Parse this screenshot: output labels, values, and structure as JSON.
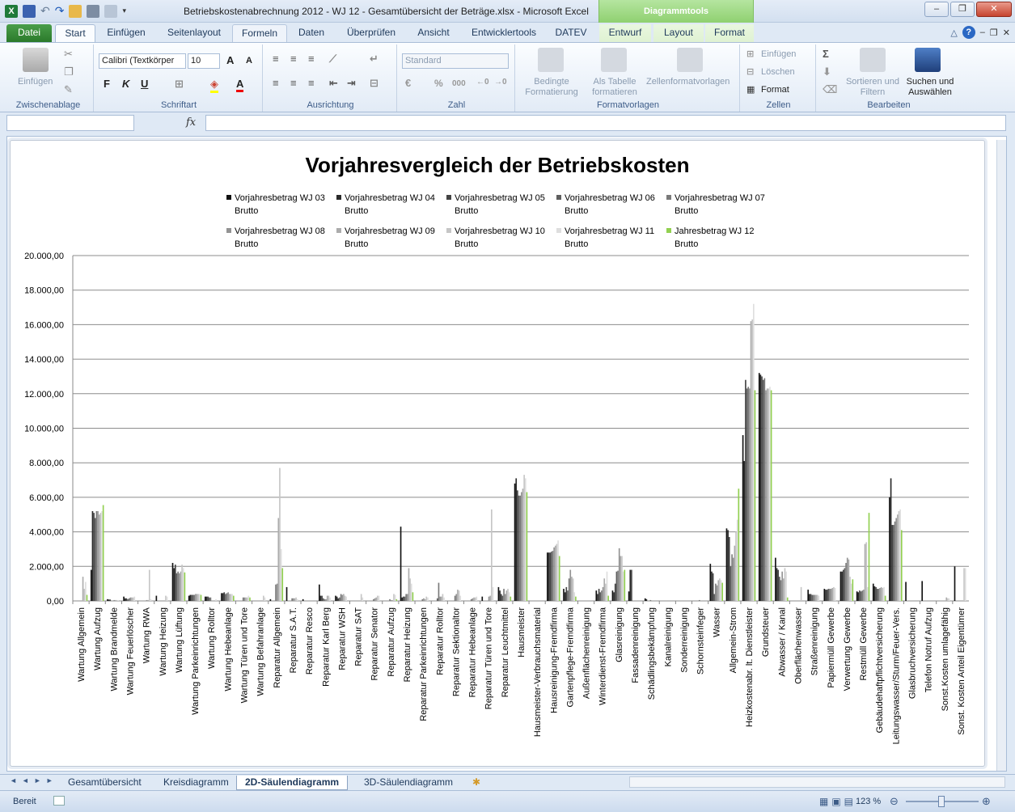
{
  "window": {
    "title": "Betriebskostenabrechnung 2012 - WJ 12 - Gesamtübersicht der Beträge.xlsx - Microsoft Excel",
    "context_group": "Diagrammtools"
  },
  "tabs": [
    "Datei",
    "Start",
    "Einfügen",
    "Seitenlayout",
    "Formeln",
    "Daten",
    "Überprüfen",
    "Ansicht",
    "Entwicklertools",
    "DATEV",
    "Entwurf",
    "Layout",
    "Format"
  ],
  "active_tab": "Start",
  "ribbon": {
    "clipboard": {
      "label": "Zwischenablage",
      "paste": "Einfügen"
    },
    "font": {
      "label": "Schriftart",
      "name": "Calibri (Textkörper",
      "size": "10",
      "bold": "F",
      "italic": "K",
      "underline": "U",
      "grow": "A",
      "shrink": "A",
      "color_glyph": "A"
    },
    "alignment": {
      "label": "Ausrichtung"
    },
    "number": {
      "label": "Zahl",
      "format": "Standard",
      "percent": "%",
      "thousands": "000"
    },
    "styles": {
      "label": "Formatvorlagen",
      "conditional": "Bedingte Formatierung",
      "as_table": "Als Tabelle formatieren",
      "cell_styles": "Zellenformatvorlagen"
    },
    "cells": {
      "label": "Zellen",
      "insert": "Einfügen",
      "delete": "Löschen",
      "format": "Format"
    },
    "editing": {
      "label": "Bearbeiten",
      "sum": "Σ",
      "sort": "Sortieren und Filtern",
      "find": "Suchen und Auswählen"
    }
  },
  "formula_bar": {
    "name_box": "",
    "fx": "fx",
    "content": ""
  },
  "sheet_tabs": [
    "Gesamtübersicht",
    "Kreisdiagramm",
    "2D-Säulendiagramm",
    "3D-Säulendiagramm"
  ],
  "active_sheet": "2D-Säulendiagramm",
  "status": {
    "ready": "Bereit",
    "zoom": "123 %"
  },
  "chart_data": {
    "type": "bar",
    "title": "Vorjahresvergleich der Betriebskosten",
    "legend_position": "top",
    "grid": true,
    "ylim": [
      0,
      20000
    ],
    "yticks": [
      "0,00",
      "2.000,00",
      "4.000,00",
      "6.000,00",
      "8.000,00",
      "10.000,00",
      "12.000,00",
      "14.000,00",
      "16.000,00",
      "18.000,00",
      "20.000,00"
    ],
    "categories": [
      "Wartung Allgemein",
      "Wartung Aufzug",
      "Wartung Brandmelde",
      "Wartung Feuerlöscher",
      "Wartung RWA",
      "Wartung Heizung",
      "Wartung Lüftung",
      "Wartung Parkeinrichtungen",
      "Wartung Rolltor",
      "Wartung Hebeanlage",
      "Wartung Türen und Tore",
      "Wartung Befahranlage",
      "Reparatur Allgemein",
      "Reparatur S.A.T.",
      "Reparatur Resco",
      "Reparatur Karl Berg",
      "Reparatur WSH",
      "Reparatur SAT",
      "Reparatur Senator",
      "Reparatur Aufzug",
      "Reparatur Heizung",
      "Reparatur Parkeinrichtungen",
      "Reparatur Rolltor",
      "Reparatur Sektionaltor",
      "Reparatur Hebeanlage",
      "Reparatur Türen und Tore",
      "Reparatur Leuchtmittel",
      "Hausmeister",
      "Hausmeister-Verbrauchsmaterial",
      "Hausreinigung-Fremdfirma",
      "Gartenpflege-Fremdfirma",
      "Außenflächenreinigung",
      "Winterdienst-Fremdfirma",
      "Glasreinigung",
      "Fassadenreinigung",
      "Schädlingsbekämpfung",
      "Kanalreinigung",
      "Sonderreinigung",
      "Schornsteinfeger",
      "Wasser",
      "Allgemein-Strom",
      "Heizkostenabr. lt. Dienstleister",
      "Grundsteuer",
      "Abwasser / Kanal",
      "Oberflächenwasser",
      "Straßenreinigung",
      "Papiermüll Gewerbe",
      "Verwertung Gewerbe",
      "Restmüll Gewerbe",
      "Gebäudehaftpflichtversicherung",
      "Leitungswasser/Sturm/Feuer-Vers.",
      "Glasbruchversicherung",
      "Telefon Notruf Aufzug",
      "Sonst.Kosten umlagefähig",
      "Sonst. Kosten Anteil Eigentümer"
    ],
    "series": [
      {
        "name": "Vorjahresbetrag WJ 03 Brutto",
        "color": "#111111",
        "values": [
          0,
          1800,
          100,
          250,
          0,
          300,
          2200,
          300,
          250,
          450,
          0,
          0,
          100,
          800,
          100,
          950,
          300,
          0,
          0,
          0,
          4300,
          0,
          0,
          0,
          0,
          250,
          800,
          6800,
          0,
          2800,
          700,
          0,
          600,
          600,
          550,
          150,
          0,
          0,
          0,
          2150,
          4200,
          9600,
          13200,
          2500,
          0,
          650,
          700,
          1700,
          550,
          1000,
          6000,
          1100,
          1150,
          0,
          2000
        ]
      },
      {
        "name": "Vorjahresbetrag WJ 04 Brutto",
        "color": "#2a2a2a",
        "values": [
          0,
          5200,
          80,
          150,
          0,
          0,
          1900,
          350,
          250,
          450,
          0,
          0,
          0,
          0,
          0,
          300,
          250,
          0,
          0,
          0,
          200,
          0,
          0,
          0,
          0,
          0,
          600,
          7100,
          0,
          2800,
          500,
          0,
          400,
          500,
          1800,
          100,
          0,
          0,
          0,
          1700,
          4100,
          8100,
          13100,
          1900,
          0,
          400,
          650,
          1700,
          500,
          850,
          7100,
          0,
          0,
          0,
          0
        ]
      },
      {
        "name": "Vorjahresbetrag WJ 05 Brutto",
        "color": "#444444",
        "values": [
          0,
          5100,
          80,
          150,
          0,
          0,
          2100,
          350,
          250,
          500,
          0,
          0,
          0,
          0,
          0,
          300,
          150,
          0,
          0,
          0,
          250,
          0,
          0,
          0,
          0,
          0,
          400,
          6400,
          0,
          2800,
          800,
          0,
          700,
          1000,
          1800,
          0,
          0,
          0,
          0,
          1600,
          3700,
          12800,
          13000,
          1800,
          0,
          400,
          650,
          1800,
          600,
          800,
          4400,
          0,
          0,
          0,
          0
        ]
      },
      {
        "name": "Vorjahresbetrag WJ 06 Brutto",
        "color": "#5f5f5f",
        "values": [
          0,
          4800,
          0,
          100,
          0,
          0,
          1600,
          350,
          200,
          400,
          0,
          0,
          0,
          0,
          0,
          150,
          200,
          0,
          0,
          0,
          250,
          0,
          150,
          0,
          0,
          0,
          300,
          6100,
          0,
          2850,
          600,
          0,
          500,
          1700,
          0,
          0,
          0,
          0,
          0,
          400,
          2000,
          12300,
          12800,
          1400,
          0,
          350,
          700,
          1900,
          550,
          700,
          4400,
          0,
          0,
          0,
          0
        ]
      },
      {
        "name": "Vorjahresbetrag WJ 07 Brutto",
        "color": "#7a7a7a",
        "values": [
          0,
          5200,
          0,
          150,
          0,
          0,
          1700,
          350,
          200,
          450,
          200,
          0,
          950,
          150,
          0,
          100,
          400,
          0,
          100,
          100,
          400,
          100,
          1050,
          300,
          100,
          0,
          700,
          6100,
          0,
          2900,
          1300,
          0,
          600,
          1750,
          0,
          50,
          0,
          0,
          50,
          1000,
          2700,
          12400,
          12900,
          1200,
          0,
          350,
          700,
          2200,
          600,
          700,
          4600,
          0,
          0,
          0,
          0
        ]
      },
      {
        "name": "Vorjahresbetrag WJ 08 Brutto",
        "color": "#939393",
        "values": [
          0,
          5200,
          50,
          200,
          50,
          0,
          1600,
          400,
          0,
          500,
          200,
          0,
          1000,
          150,
          0,
          100,
          350,
          0,
          150,
          50,
          400,
          150,
          250,
          400,
          150,
          250,
          400,
          6300,
          0,
          3100,
          1800,
          0,
          800,
          3050,
          0,
          0,
          0,
          0,
          0,
          900,
          2500,
          12300,
          12200,
          1700,
          0,
          350,
          700,
          2500,
          650,
          750,
          4800,
          0,
          0,
          0,
          0
        ]
      },
      {
        "name": "Vorjahresbetrag WJ 09 Brutto",
        "color": "#acacac",
        "values": [
          1400,
          5000,
          50,
          200,
          50,
          0,
          1700,
          400,
          0,
          400,
          200,
          0,
          4800,
          150,
          0,
          300,
          400,
          0,
          200,
          50,
          1900,
          100,
          250,
          650,
          200,
          300,
          600,
          6500,
          0,
          3200,
          1400,
          0,
          1300,
          2600,
          0,
          0,
          0,
          0,
          0,
          1200,
          3200,
          16200,
          12300,
          1300,
          0,
          350,
          750,
          2400,
          3300,
          800,
          5000,
          0,
          0,
          200,
          0
        ]
      },
      {
        "name": "Vorjahresbetrag WJ 10 Brutto",
        "color": "#c6c6c6",
        "values": [
          700,
          5100,
          50,
          200,
          1800,
          300,
          2100,
          400,
          0,
          400,
          200,
          300,
          7700,
          200,
          0,
          300,
          300,
          400,
          300,
          400,
          1300,
          250,
          400,
          600,
          200,
          5300,
          700,
          7300,
          0,
          3300,
          1300,
          0,
          1000,
          2600,
          0,
          0,
          0,
          0,
          0,
          1300,
          4000,
          16300,
          12300,
          1900,
          800,
          350,
          800,
          1400,
          3400,
          750,
          5200,
          0,
          0,
          150,
          1900
        ]
      },
      {
        "name": "Vorjahresbetrag WJ 11 Brutto",
        "color": "#dedede",
        "values": [
          1100,
          5200,
          50,
          250,
          100,
          250,
          1900,
          400,
          100,
          400,
          300,
          200,
          3000,
          100,
          0,
          200,
          250,
          200,
          300,
          350,
          1000,
          200,
          200,
          300,
          250,
          800,
          500,
          7100,
          0,
          3500,
          500,
          0,
          1700,
          1700,
          0,
          0,
          0,
          0,
          0,
          1200,
          4700,
          17200,
          12400,
          1700,
          0,
          300,
          750,
          1000,
          800,
          800,
          5300,
          0,
          0,
          150,
          1900
        ]
      },
      {
        "name": "Jahresbetrag WJ 12 Brutto",
        "color": "#92d050",
        "values": [
          350,
          5550,
          0,
          0,
          0,
          0,
          1650,
          350,
          0,
          300,
          200,
          0,
          1900,
          0,
          0,
          0,
          0,
          0,
          0,
          100,
          500,
          0,
          0,
          0,
          0,
          0,
          250,
          6300,
          0,
          2600,
          250,
          0,
          300,
          1800,
          0,
          0,
          0,
          0,
          0,
          1050,
          6500,
          12200,
          12200,
          200,
          0,
          0,
          0,
          1250,
          5100,
          300,
          4100,
          0,
          0,
          0,
          0
        ]
      }
    ]
  }
}
